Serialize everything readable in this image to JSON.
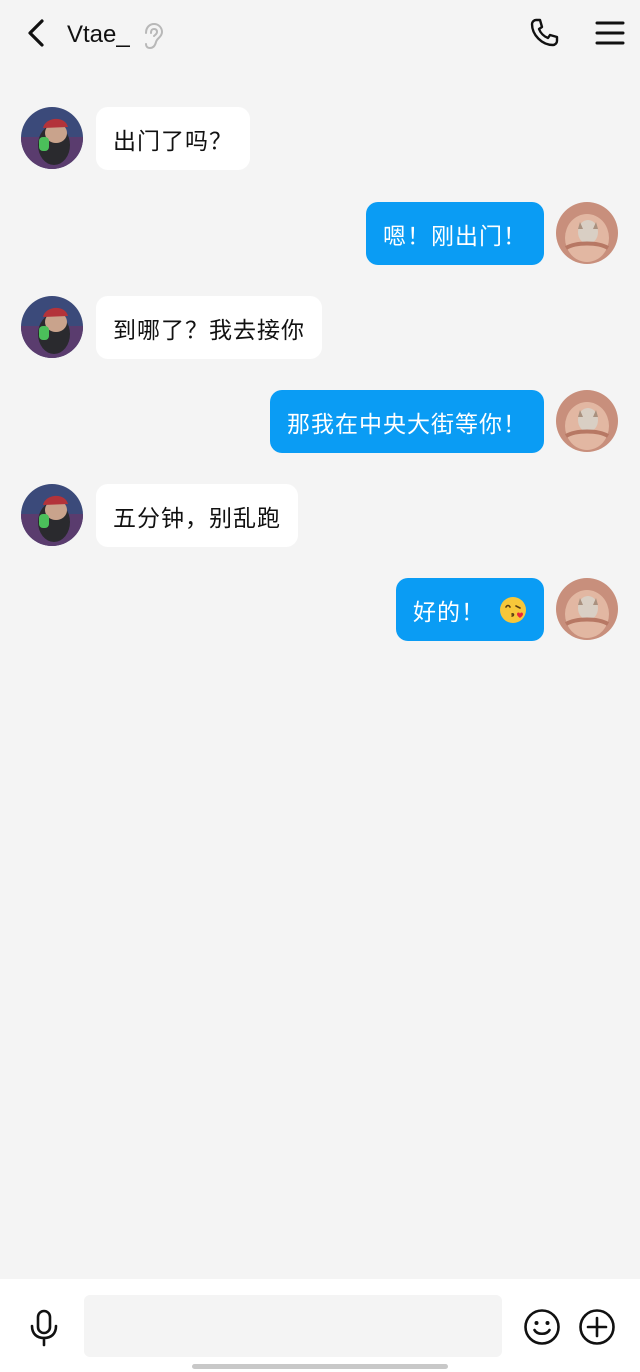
{
  "header": {
    "back_icon": "chevron-left-icon",
    "title": "Vtae_",
    "ear_icon": "ear-icon",
    "call_icon": "phone-icon",
    "menu_icon": "hamburger-menu-icon"
  },
  "messages": [
    {
      "direction": "in",
      "text": "出门了吗？"
    },
    {
      "direction": "out",
      "text": "嗯！刚出门！"
    },
    {
      "direction": "in",
      "text": "到哪了？我去接你"
    },
    {
      "direction": "out",
      "text": "那我在中央大街等你！"
    },
    {
      "direction": "in",
      "text": "五分钟，别乱跑"
    },
    {
      "direction": "out",
      "text": "好的！",
      "emoji": "kissing-face-icon"
    }
  ],
  "composer": {
    "voice_icon": "microphone-icon",
    "input_value": "",
    "emoji_icon": "smiley-icon",
    "plus_icon": "plus-circle-icon"
  },
  "colors": {
    "background": "#f4f4f4",
    "outgoing_bubble": "#0a9cf4",
    "incoming_bubble": "#ffffff",
    "text": "#111111"
  }
}
